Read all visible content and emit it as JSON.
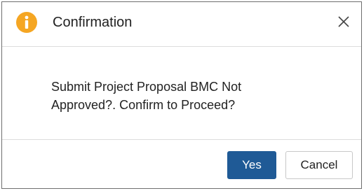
{
  "dialog": {
    "title": "Confirmation",
    "message_line1": "Submit Project Proposal BMC Not",
    "message_line2": "Approved?. Confirm to Proceed?",
    "icons": {
      "header": "info-icon",
      "close": "close-icon"
    },
    "buttons": {
      "yes_label": "Yes",
      "cancel_label": "Cancel"
    },
    "colors": {
      "info_icon": "#f5a623",
      "primary_button": "#1f5a96",
      "primary_button_text": "#ffffff"
    }
  }
}
